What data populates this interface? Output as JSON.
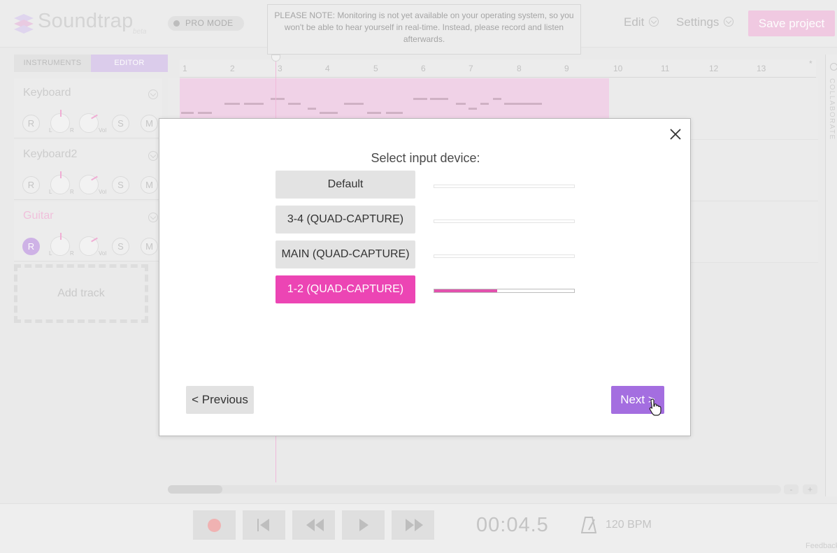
{
  "header": {
    "logo_text": "Soundtrap",
    "logo_beta": "beta",
    "pro_mode": "PRO MODE",
    "notice": "PLEASE NOTE: Monitoring is not yet available on your operating system, so you won't be able to hear yourself in real-time. Instead, please record and listen afterwards.",
    "edit": "Edit",
    "settings": "Settings",
    "save_project": "Save project"
  },
  "tabs": {
    "instruments": "INSTRUMENTS",
    "editor": "EDITOR"
  },
  "tracks": [
    {
      "name": "Keyboard",
      "r": "R",
      "s": "S",
      "m": "M",
      "l": "L",
      "rr": "R",
      "vol": "Vol"
    },
    {
      "name": "Keyboard2",
      "r": "R",
      "s": "S",
      "m": "M",
      "l": "L",
      "rr": "R",
      "vol": "Vol"
    },
    {
      "name": "Guitar",
      "r": "R",
      "s": "S",
      "m": "M",
      "l": "L",
      "rr": "R",
      "vol": "Vol"
    }
  ],
  "add_track": "Add track",
  "ruler": {
    "marks": [
      "1",
      "2",
      "3",
      "4",
      "5",
      "6",
      "7",
      "8",
      "9",
      "10",
      "11",
      "12",
      "13"
    ],
    "end": "*"
  },
  "collaborate": "COLLABORATE",
  "zoom": {
    "minus": "-",
    "plus": "+"
  },
  "transport": {
    "time": "00:04.5",
    "bpm": "120 BPM",
    "feedback": "Feedback"
  },
  "modal": {
    "title": "Select input device:",
    "devices": [
      {
        "label": "Default",
        "level": 0
      },
      {
        "label": "3-4 (QUAD-CAPTURE)",
        "level": 0
      },
      {
        "label": "MAIN (QUAD-CAPTURE)",
        "level": 0
      },
      {
        "label": "1-2 (QUAD-CAPTURE)",
        "level": 0.45
      }
    ],
    "selected_index": 3,
    "previous": "< Previous",
    "next": "Next >"
  },
  "colors": {
    "accent_pink": "#ec45b4",
    "accent_purple": "#a46ee0"
  }
}
